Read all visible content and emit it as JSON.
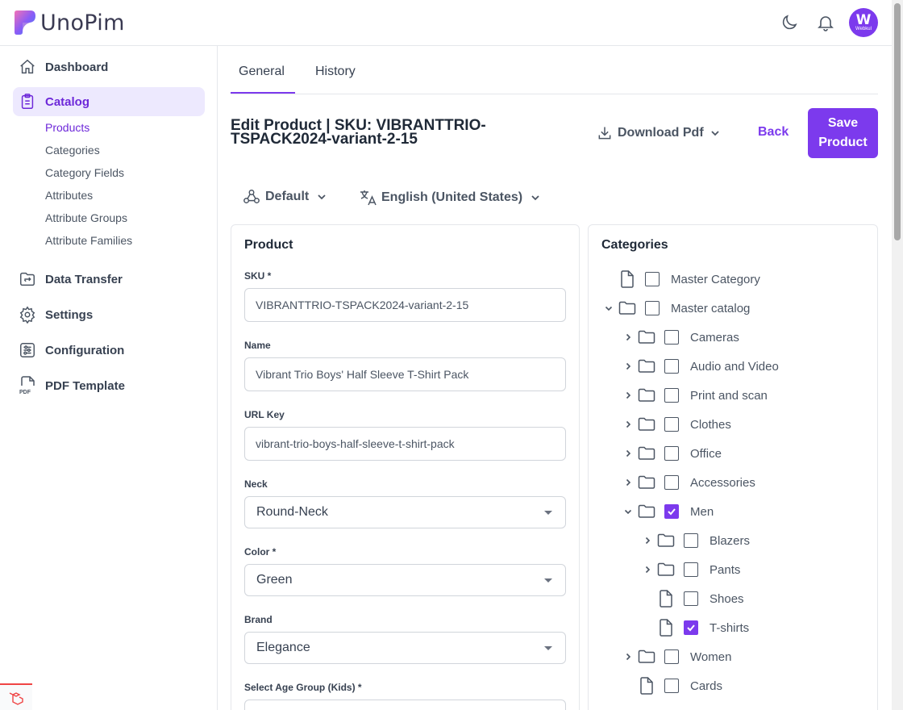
{
  "brand": {
    "name": "UnoPim",
    "avatar_initial": "W",
    "avatar_caption": "Webkul"
  },
  "sidebar": {
    "items": [
      {
        "label": "Dashboard",
        "icon": "home-icon"
      },
      {
        "label": "Catalog",
        "icon": "clipboard-icon",
        "active": true
      },
      {
        "label": "Data Transfer",
        "icon": "folder-transfer-icon"
      },
      {
        "label": "Settings",
        "icon": "gear-icon"
      },
      {
        "label": "Configuration",
        "icon": "sliders-icon"
      },
      {
        "label": "PDF Template",
        "icon": "pdf-file-icon"
      }
    ],
    "catalog_sub": [
      "Products",
      "Categories",
      "Category Fields",
      "Attributes",
      "Attribute Groups",
      "Attribute Families"
    ]
  },
  "tabs": [
    "General",
    "History"
  ],
  "page": {
    "title": "Edit Product | SKU: VIBRANTTRIO-TSPACK2024-variant-2-15",
    "download_pdf": "Download Pdf",
    "back": "Back",
    "save": "Save Product",
    "channel": "Default",
    "locale": "English (United States)"
  },
  "product": {
    "card_title": "Product",
    "sku_label": "SKU *",
    "sku": "VIBRANTTRIO-TSPACK2024-variant-2-15",
    "name_label": "Name",
    "name": "Vibrant Trio Boys' Half Sleeve T-Shirt Pack",
    "url_label": "URL Key",
    "url": "vibrant-trio-boys-half-sleeve-t-shirt-pack",
    "neck_label": "Neck",
    "neck": "Round-Neck",
    "color_label": "Color *",
    "color": "Green",
    "brand_label": "Brand",
    "brand": "Elegance",
    "age_label": "Select Age Group (Kids) *"
  },
  "categories": {
    "card_title": "Categories",
    "tree": [
      {
        "label": "Master Category",
        "type": "file",
        "checked": false,
        "level": 0,
        "chevron": "none"
      },
      {
        "label": "Master catalog",
        "type": "folder",
        "checked": false,
        "level": 0,
        "chevron": "down"
      },
      {
        "label": "Cameras",
        "type": "folder",
        "checked": false,
        "level": 1,
        "chevron": "right"
      },
      {
        "label": "Audio and Video",
        "type": "folder",
        "checked": false,
        "level": 1,
        "chevron": "right"
      },
      {
        "label": "Print and scan",
        "type": "folder",
        "checked": false,
        "level": 1,
        "chevron": "right"
      },
      {
        "label": "Clothes",
        "type": "folder",
        "checked": false,
        "level": 1,
        "chevron": "right"
      },
      {
        "label": "Office",
        "type": "folder",
        "checked": false,
        "level": 1,
        "chevron": "right"
      },
      {
        "label": "Accessories",
        "type": "folder",
        "checked": false,
        "level": 1,
        "chevron": "right"
      },
      {
        "label": "Men",
        "type": "folder",
        "checked": true,
        "level": 1,
        "chevron": "down"
      },
      {
        "label": "Blazers",
        "type": "folder",
        "checked": false,
        "level": 2,
        "chevron": "right"
      },
      {
        "label": "Pants",
        "type": "folder",
        "checked": false,
        "level": 2,
        "chevron": "right"
      },
      {
        "label": "Shoes",
        "type": "file",
        "checked": false,
        "level": 2,
        "chevron": "none"
      },
      {
        "label": "T-shirts",
        "type": "file",
        "checked": true,
        "level": 2,
        "chevron": "none"
      },
      {
        "label": "Women",
        "type": "folder",
        "checked": false,
        "level": 1,
        "chevron": "right"
      },
      {
        "label": "Cards",
        "type": "file",
        "checked": false,
        "level": 1,
        "chevron": "none"
      }
    ]
  },
  "colors": {
    "accent": "#7c3aed",
    "accent_light": "#ede9fe"
  }
}
